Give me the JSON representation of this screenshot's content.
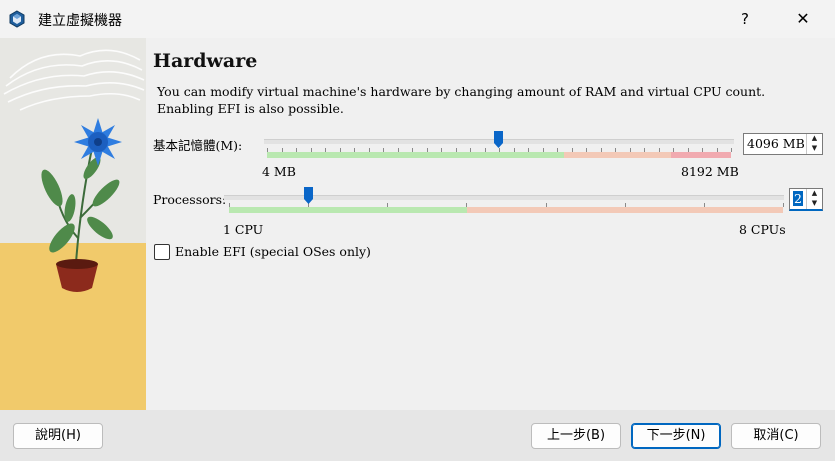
{
  "window": {
    "title": "建立虛擬機器",
    "help": "?",
    "close": "✕"
  },
  "page": {
    "heading": "Hardware",
    "description": [
      "You can modify virtual machine's hardware by changing amount of RAM and virtual CPU count.",
      "Enabling EFI is also possible."
    ]
  },
  "memory": {
    "label": "基本記憶體(M):",
    "value": "4096 MB",
    "min_label": "4 MB",
    "max_label": "8192 MB",
    "min": 4,
    "max": 8192,
    "current": 4096,
    "recommended_end": 0.64,
    "warn_end": 0.87
  },
  "processors": {
    "label": "Processors:",
    "value": "2",
    "min_label": "1 CPU",
    "max_label": "8 CPUs",
    "min": 1,
    "max": 8,
    "current": 2,
    "recommended_end": 0.43
  },
  "efi": {
    "label": "Enable EFI (special OSes only)",
    "checked": false
  },
  "buttons": {
    "help": "說明(H)",
    "back": "上一步(B)",
    "next": "下一步(N)",
    "cancel": "取消(C)"
  },
  "colors": {
    "ok": "#b9e8b0",
    "warn": "#f3c9b7",
    "bad": "#f1aab0",
    "thumb": "#0a66c8",
    "accent": "#0067c0"
  }
}
